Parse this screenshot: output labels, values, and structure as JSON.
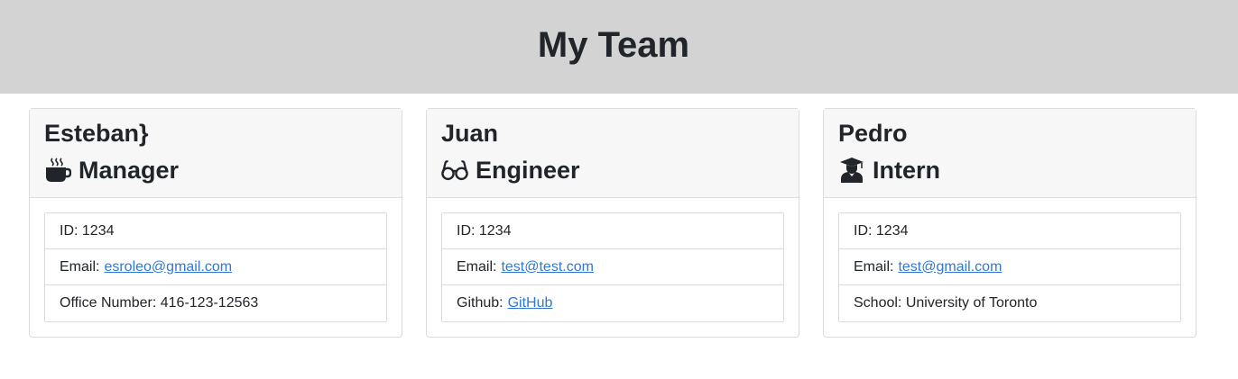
{
  "header": {
    "title": "My Team"
  },
  "cards": [
    {
      "name": "Esteban}",
      "role": "Manager",
      "icon": "coffee-mug-icon",
      "id_text": "ID: 1234",
      "email_label": "Email:",
      "email": "esroleo@gmail.com",
      "extra_text": "Office Number: 416-123-12563"
    },
    {
      "name": "Juan",
      "role": "Engineer",
      "icon": "glasses-icon",
      "id_text": "ID: 1234",
      "email_label": "Email:",
      "email": "test@test.com",
      "extra_label": "Github:",
      "extra_link": "GitHub"
    },
    {
      "name": "Pedro",
      "role": "Intern",
      "icon": "graduate-icon",
      "id_text": "ID: 1234",
      "email_label": "Email:",
      "email": "test@gmail.com",
      "extra_text": "School: University of Toronto"
    }
  ]
}
